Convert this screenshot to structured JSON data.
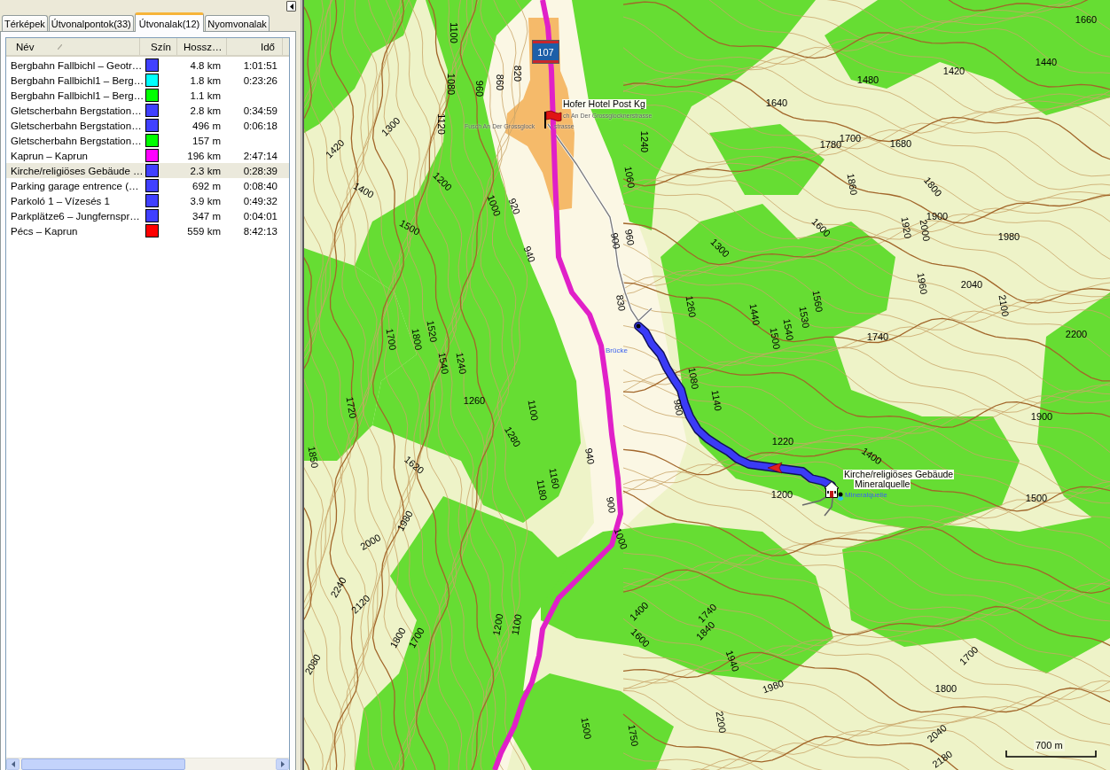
{
  "panel": {
    "tabs": [
      {
        "label": "Térképek",
        "selected": false
      },
      {
        "label": "Útvonalpontok(33)",
        "selected": false
      },
      {
        "label": "Útvonalak(12)",
        "selected": true
      },
      {
        "label": "Nyomvonalak",
        "selected": false
      }
    ]
  },
  "route_table": {
    "columns": [
      "Név",
      "Szín",
      "Hossz…",
      "Idő"
    ],
    "rows": [
      {
        "name": "Bergbahn Fallbichl – Geotr…",
        "color": "#4040ff",
        "length": "4.8 km",
        "time": "1:01:51",
        "selected": false
      },
      {
        "name": "Bergbahn Fallbichl1 – Berg…",
        "color": "#00ffff",
        "length": "1.8 km",
        "time": "0:23:26",
        "selected": false
      },
      {
        "name": "Bergbahn Fallbichl1 – Berg…",
        "color": "#00ff00",
        "length": "1.1 km",
        "selected": false
      },
      {
        "name": "Gletscherbahn Bergstation…",
        "color": "#4040ff",
        "length": "2.8 km",
        "time": "0:34:59",
        "selected": false
      },
      {
        "name": "Gletscherbahn Bergstation…",
        "color": "#4040ff",
        "length": "496 m",
        "time": "0:06:18",
        "selected": false
      },
      {
        "name": "Gletscherbahn Bergstation…",
        "color": "#00ff00",
        "length": "157 m",
        "selected": false
      },
      {
        "name": "Kaprun – Kaprun",
        "color": "#ff00ff",
        "length": "196 km",
        "time": "2:47:14",
        "selected": false
      },
      {
        "name": "Kirche/religiöses Gebäude …",
        "color": "#4040ff",
        "length": "2.3 km",
        "time": "0:28:39",
        "selected": true
      },
      {
        "name": "Parking garage entrence (…",
        "color": "#4040ff",
        "length": "692 m",
        "time": "0:08:40",
        "selected": false
      },
      {
        "name": "Parkoló 1 – Vízesés 1",
        "color": "#4040ff",
        "length": "3.9 km",
        "time": "0:49:32",
        "selected": false
      },
      {
        "name": "Parkplätze6 – Jungfernspr…",
        "color": "#4040ff",
        "length": "347 m",
        "time": "0:04:01",
        "selected": false
      },
      {
        "name": "Pécs – Kaprun",
        "color": "#ff0000",
        "length": "559 km",
        "time": "8:42:13",
        "selected": false
      }
    ]
  },
  "map": {
    "road_number": "107",
    "labels": [
      {
        "kind": "poi",
        "text": "Hofer Hotel Post Kg"
      },
      {
        "kind": "street",
        "text": "ch An Der Grossglocknerstrasse"
      },
      {
        "kind": "street",
        "text": "Fusch An Der Grossglock"
      },
      {
        "kind": "street",
        "text": "strasse"
      },
      {
        "kind": "feature",
        "text": "Brücke"
      },
      {
        "kind": "poi",
        "text": "Kirche/religiöses Gebäude"
      },
      {
        "kind": "poi",
        "text": "Mineralquelle"
      },
      {
        "kind": "feature",
        "text": "Mineralquelle"
      }
    ],
    "elevation_labels": [
      "1100",
      "1080",
      "960",
      "860",
      "820",
      "1120",
      "1300",
      "1420",
      "1400",
      "1200",
      "1000",
      "920",
      "940",
      "1500",
      "1240",
      "1060",
      "960",
      "900",
      "1300",
      "1600",
      "1640",
      "1780",
      "1700",
      "1680",
      "1860",
      "1800",
      "1900",
      "1920",
      "2000",
      "1980",
      "1480",
      "1420",
      "1440",
      "1660",
      "2040",
      "2100",
      "1960",
      "2200",
      "1740",
      "1560",
      "1530",
      "1540",
      "1500",
      "1440",
      "1260",
      "830",
      "1080",
      "1140",
      "980",
      "1220",
      "1400",
      "1200",
      "1900",
      "1500",
      "1700",
      "1800",
      "1520",
      "1240",
      "1540",
      "1260",
      "1100",
      "1280",
      "1720",
      "1620",
      "940",
      "1160",
      "1180",
      "900",
      "1000",
      "1850",
      "2000",
      "1980",
      "2240",
      "2120",
      "1800",
      "1700",
      "2080",
      "1200",
      "1100",
      "1400",
      "1600",
      "1740",
      "1840",
      "1940",
      "1980",
      "1700",
      "1800",
      "2200",
      "1500",
      "1750",
      "2040",
      "2180"
    ],
    "scale": "700 m"
  }
}
